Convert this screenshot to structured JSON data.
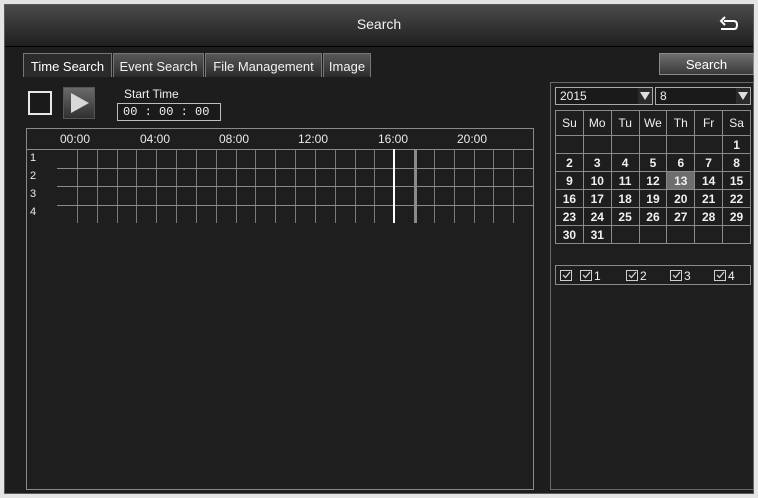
{
  "window": {
    "title": "Search"
  },
  "tabs": [
    {
      "label": "Time Search",
      "active": true
    },
    {
      "label": "Event Search"
    },
    {
      "label": "File Management"
    },
    {
      "label": "Image"
    }
  ],
  "search_button": "Search",
  "start_time": {
    "label": "Start Time",
    "value": "00 : 00 : 00"
  },
  "timeline": {
    "hours": [
      "00:00",
      "04:00",
      "08:00",
      "12:00",
      "16:00",
      "20:00"
    ],
    "channels": [
      "1",
      "2",
      "3",
      "4"
    ]
  },
  "calendar": {
    "year": "2015",
    "month": "8",
    "weekdays": [
      "Su",
      "Mo",
      "Tu",
      "We",
      "Th",
      "Fr",
      "Sa"
    ],
    "weeks": [
      [
        "",
        "",
        "",
        "",
        "",
        "",
        "1"
      ],
      [
        "2",
        "3",
        "4",
        "5",
        "6",
        "7",
        "8"
      ],
      [
        "9",
        "10",
        "11",
        "12",
        "13",
        "14",
        "15"
      ],
      [
        "16",
        "17",
        "18",
        "19",
        "20",
        "21",
        "22"
      ],
      [
        "23",
        "24",
        "25",
        "26",
        "27",
        "28",
        "29"
      ],
      [
        "30",
        "31",
        "",
        "",
        "",
        "",
        ""
      ]
    ],
    "selected_day": "13"
  },
  "channel_checks": [
    {
      "label": "",
      "checked": true
    },
    {
      "label": "1",
      "checked": true
    },
    {
      "label": "2",
      "checked": true
    },
    {
      "label": "3",
      "checked": true
    },
    {
      "label": "4",
      "checked": true
    }
  ],
  "colors": {
    "background": "#1d1d1d",
    "selected_day": "#6e6e6e",
    "cursor": "#ffffff"
  }
}
